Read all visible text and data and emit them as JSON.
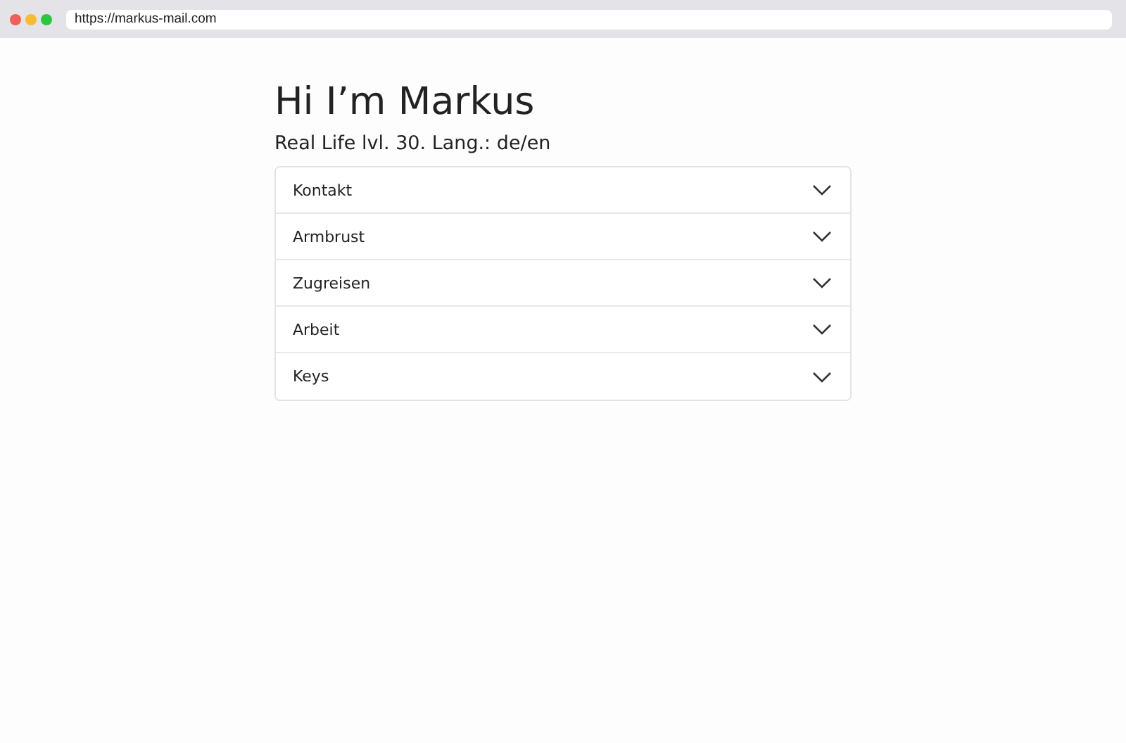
{
  "browser": {
    "url": "https://markus-mail.com"
  },
  "heading": "Hi I’m Markus",
  "subtitle": "Real Life lvl. 30. Lang.: de/en",
  "accordion": [
    {
      "label": "Kontakt",
      "expanded": false
    },
    {
      "label": "Armbrust",
      "expanded": false
    },
    {
      "label": "Zugreisen",
      "expanded": false
    },
    {
      "label": "Arbeit",
      "expanded": false
    },
    {
      "label": "Keys",
      "expanded": false
    }
  ]
}
